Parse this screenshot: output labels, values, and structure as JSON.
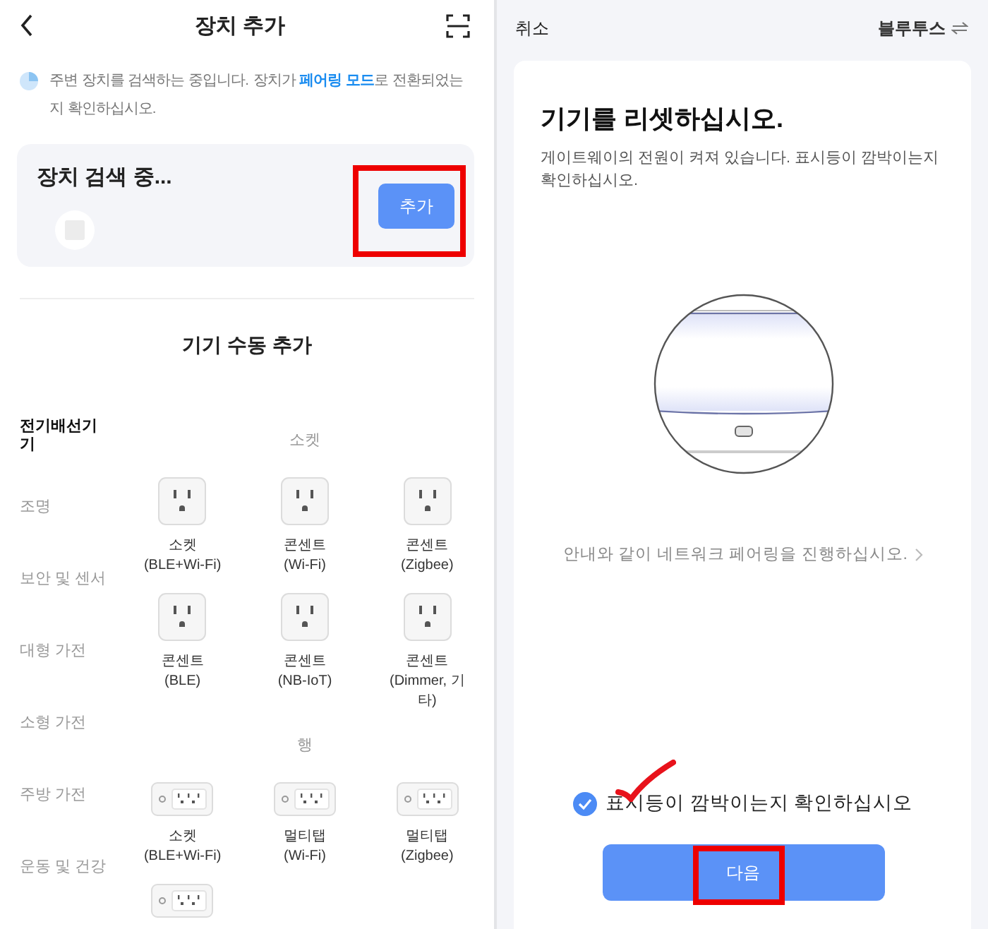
{
  "left": {
    "header": {
      "title": "장치 추가"
    },
    "notice": {
      "before": "주변 장치를 검색하는 중입니다. 장치가 ",
      "link": "페어링 모드",
      "after": "로 전환되었는지 확인하십시오."
    },
    "scanning": {
      "title": "장치 검색 중...",
      "button": "추가"
    },
    "manual": {
      "title": "기기 수동 추가",
      "categories": [
        {
          "label": "전기배선기기",
          "selected": true
        },
        {
          "label": "조명",
          "selected": false
        },
        {
          "label": "보안 및 센서",
          "selected": false
        },
        {
          "label": "대형 가전",
          "selected": false
        },
        {
          "label": "소형 가전",
          "selected": false
        },
        {
          "label": "주방 가전",
          "selected": false
        },
        {
          "label": "운동 및 건강",
          "selected": false
        }
      ],
      "sections": [
        {
          "title": "소켓",
          "items": [
            {
              "kind": "socket",
              "label": "소켓\n(BLE+Wi-Fi)"
            },
            {
              "kind": "socket",
              "label": "콘센트\n(Wi-Fi)"
            },
            {
              "kind": "socket",
              "label": "콘센트\n(Zigbee)"
            },
            {
              "kind": "socket",
              "label": "콘센트\n(BLE)"
            },
            {
              "kind": "socket",
              "label": "콘센트\n(NB-IoT)"
            },
            {
              "kind": "socket",
              "label": "콘센트\n(Dimmer, 기타)"
            }
          ]
        },
        {
          "title": "행",
          "items": [
            {
              "kind": "power_strip",
              "label": "소켓\n(BLE+Wi-Fi)"
            },
            {
              "kind": "power_strip",
              "label": "멀티탭\n(Wi-Fi)"
            },
            {
              "kind": "power_strip",
              "label": "멀티탭\n(Zigbee)"
            },
            {
              "kind": "power_strip"
            }
          ]
        }
      ]
    }
  },
  "right": {
    "header": {
      "cancel": "취소",
      "mode": "블루투스"
    },
    "card": {
      "title": "기기를 리셋하십시오.",
      "description": "게이트웨이의 전원이 켜져 있습니다. 표시등이 깜박이는지 확인하십시오.",
      "guide": "안내와 같이 네트워크 페어링을 진행하십시오.",
      "confirm": {
        "label": "표시등이 깜박이는지 확인하십시오",
        "checked": true
      },
      "next": "다음"
    }
  }
}
